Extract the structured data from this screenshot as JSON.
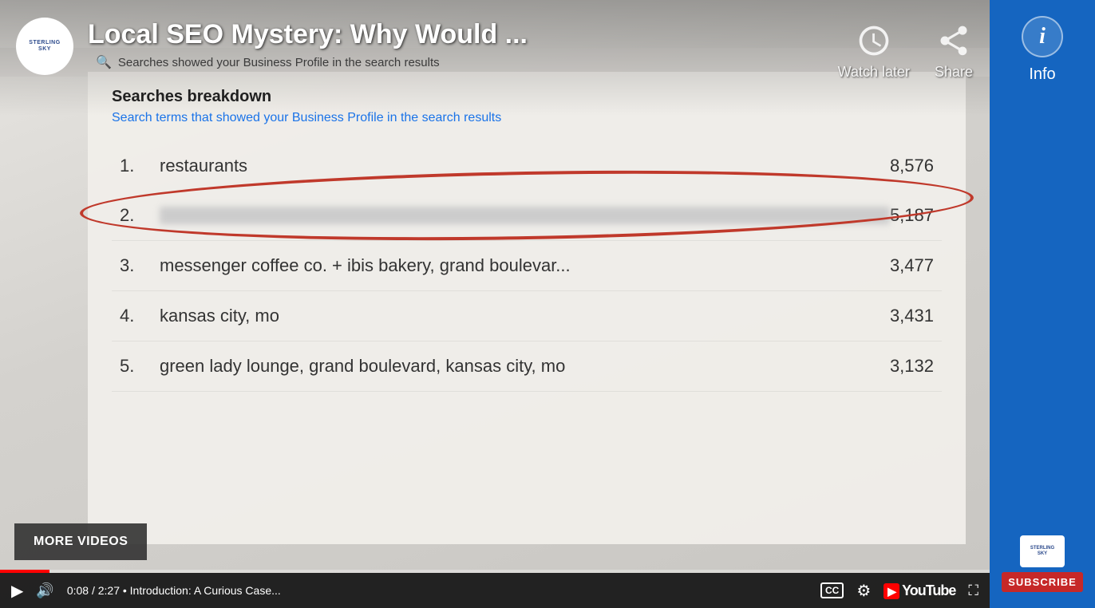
{
  "video": {
    "title": "Local SEO Mystery: Why Would ...",
    "channel": "STERLING SKY",
    "time_current": "0:08",
    "time_total": "2:27",
    "chapter": "Introduction: A Curious Case...",
    "progress_percent": 5
  },
  "controls": {
    "watch_later": "Watch later",
    "share": "Share",
    "info": "Info",
    "more_videos": "MORE VIDEOS",
    "subscribe": "SUBSCRIBE",
    "cc_label": "CC"
  },
  "searches": {
    "header_top": "Searches showed your Business Profile in the search results",
    "breakdown_title": "Searches breakdown",
    "breakdown_subtitle": "Search terms that showed your Business Profile in the search results",
    "items": [
      {
        "num": "1.",
        "name": "restaurants",
        "count": "8,576",
        "highlighted": true
      },
      {
        "num": "2.",
        "name": "",
        "count": "5,187",
        "blurred": true
      },
      {
        "num": "3.",
        "name": "messenger coffee co. + ibis bakery, grand boulevar...",
        "count": "3,477",
        "highlighted": false
      },
      {
        "num": "4.",
        "name": "kansas city, mo",
        "count": "3,431",
        "highlighted": false
      },
      {
        "num": "5.",
        "name": "green lady lounge, grand boulevard, kansas city, mo",
        "count": "3,132",
        "highlighted": false
      }
    ]
  },
  "sidebar": {
    "info_label": "Info",
    "subscribe_label": "SUBSCRIBE",
    "channel_small": "STERLING SKY"
  }
}
